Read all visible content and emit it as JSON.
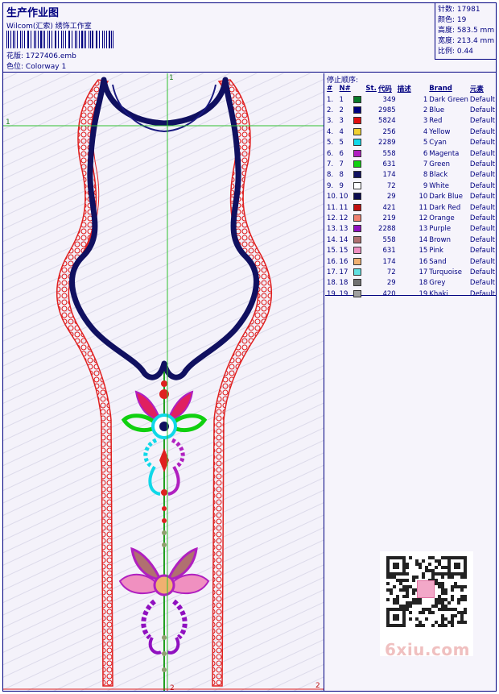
{
  "header": {
    "title": "生产作业图",
    "subtitle": "Wilcom(汇索) 绣饰工作室",
    "design_label": "花版:",
    "design_value": "1727406.emb",
    "colorway_label": "色位:",
    "colorway_value": "Colorway 1"
  },
  "stats": [
    {
      "label": "针数:",
      "value": "17981"
    },
    {
      "label": "颜色:",
      "value": "19"
    },
    {
      "label": "高度:",
      "value": "583.5 mm"
    },
    {
      "label": "宽度:",
      "value": "213.4 mm"
    },
    {
      "label": "比例:",
      "value": "0.44"
    }
  ],
  "design": {
    "marker_top": "1",
    "marker_left": "1",
    "marker_bottom": "2",
    "marker_right": "2"
  },
  "stop_sequence": {
    "title": "停止顺序:",
    "columns": [
      "#",
      "N#",
      "St.",
      "代码",
      "描述",
      "Brand",
      "元素"
    ],
    "rows": [
      {
        "idx": "1.",
        "n": "1",
        "color": "#0a7a2a",
        "st": "349",
        "code": "1",
        "desc": "Dark Green",
        "brand": "Default"
      },
      {
        "idx": "2.",
        "n": "2",
        "color": "#000080",
        "st": "2985",
        "code": "2",
        "desc": "Blue",
        "brand": "Default"
      },
      {
        "idx": "3.",
        "n": "3",
        "color": "#e01010",
        "st": "5824",
        "code": "3",
        "desc": "Red",
        "brand": "Default"
      },
      {
        "idx": "4.",
        "n": "4",
        "color": "#f0d030",
        "st": "256",
        "code": "4",
        "desc": "Yellow",
        "brand": "Default"
      },
      {
        "idx": "5.",
        "n": "5",
        "color": "#10d8e8",
        "st": "2289",
        "code": "5",
        "desc": "Cyan",
        "brand": "Default"
      },
      {
        "idx": "6.",
        "n": "6",
        "color": "#b020c0",
        "st": "558",
        "code": "6",
        "desc": "Magenta",
        "brand": "Default"
      },
      {
        "idx": "7.",
        "n": "7",
        "color": "#10d010",
        "st": "631",
        "code": "7",
        "desc": "Green",
        "brand": "Default"
      },
      {
        "idx": "8.",
        "n": "8",
        "color": "#101060",
        "st": "174",
        "code": "8",
        "desc": "Black",
        "brand": "Default"
      },
      {
        "idx": "9.",
        "n": "9",
        "color": "#ffffff",
        "st": "72",
        "code": "9",
        "desc": "White",
        "brand": "Default"
      },
      {
        "idx": "10.",
        "n": "10",
        "color": "#0a0a50",
        "st": "29",
        "code": "10",
        "desc": "Dark Blue",
        "brand": "Default"
      },
      {
        "idx": "11.",
        "n": "11",
        "color": "#c01010",
        "st": "421",
        "code": "11",
        "desc": "Dark Red",
        "brand": "Default"
      },
      {
        "idx": "12.",
        "n": "12",
        "color": "#f08070",
        "st": "219",
        "code": "12",
        "desc": "Orange",
        "brand": "Default"
      },
      {
        "idx": "13.",
        "n": "13",
        "color": "#9010c0",
        "st": "2288",
        "code": "13",
        "desc": "Purple",
        "brand": "Default"
      },
      {
        "idx": "14.",
        "n": "14",
        "color": "#b07070",
        "st": "558",
        "code": "14",
        "desc": "Brown",
        "brand": "Default"
      },
      {
        "idx": "15.",
        "n": "15",
        "color": "#f090c0",
        "st": "631",
        "code": "15",
        "desc": "Pink",
        "brand": "Default"
      },
      {
        "idx": "16.",
        "n": "16",
        "color": "#f0b070",
        "st": "174",
        "code": "16",
        "desc": "Sand",
        "brand": "Default"
      },
      {
        "idx": "17.",
        "n": "17",
        "color": "#60e0e0",
        "st": "72",
        "code": "17",
        "desc": "Turquoise",
        "brand": "Default"
      },
      {
        "idx": "18.",
        "n": "18",
        "color": "#707070",
        "st": "29",
        "code": "18",
        "desc": "Grey",
        "brand": "Default"
      },
      {
        "idx": "19.",
        "n": "19",
        "color": "#a0a0a0",
        "st": "420",
        "code": "19",
        "desc": "Khaki",
        "brand": "Default"
      }
    ]
  },
  "watermark": {
    "logo_text": "6xiu.com"
  }
}
